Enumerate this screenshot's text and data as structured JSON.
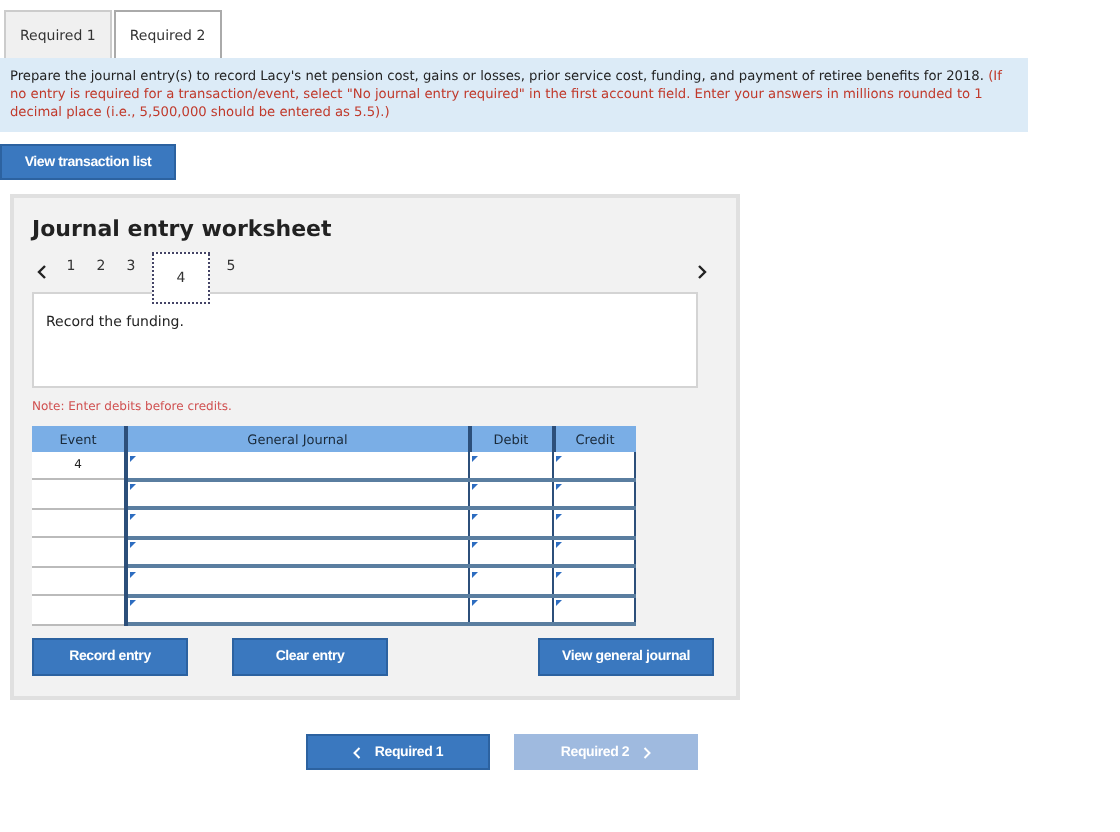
{
  "tabs": [
    {
      "label": "Required 1",
      "selected": false
    },
    {
      "label": "Required 2",
      "selected": true
    }
  ],
  "instructions": {
    "text": "Prepare the journal entry(s) to record Lacy's net pension cost, gains or losses, prior service cost, funding, and payment of retiree benefits for 2018.",
    "note": "(If no entry is required for a transaction/event, select \"No journal entry required\" in the first account field. Enter your answers in millions rounded to 1 decimal place (i.e., 5,500,000 should be entered as 5.5).)"
  },
  "view_transaction_button": "View transaction list",
  "worksheet": {
    "title": "Journal entry worksheet",
    "pages": [
      {
        "label": "1",
        "selected": false
      },
      {
        "label": "2",
        "selected": false
      },
      {
        "label": "3",
        "selected": false
      },
      {
        "label": "4",
        "selected": true
      },
      {
        "label": "5",
        "selected": false
      }
    ],
    "description": "Record the funding.",
    "note": "Note: Enter debits before credits.",
    "columns": [
      "Event",
      "General Journal",
      "Debit",
      "Credit"
    ],
    "rows": [
      {
        "event": "4"
      },
      {},
      {},
      {},
      {},
      {}
    ],
    "buttons": [
      "Record entry",
      "Clear entry",
      "View general journal"
    ]
  },
  "bottom_nav": [
    {
      "label": "Required 1",
      "kind": "back",
      "disabled": false
    },
    {
      "label": "Required 2",
      "kind": "forward",
      "disabled": true
    }
  ]
}
